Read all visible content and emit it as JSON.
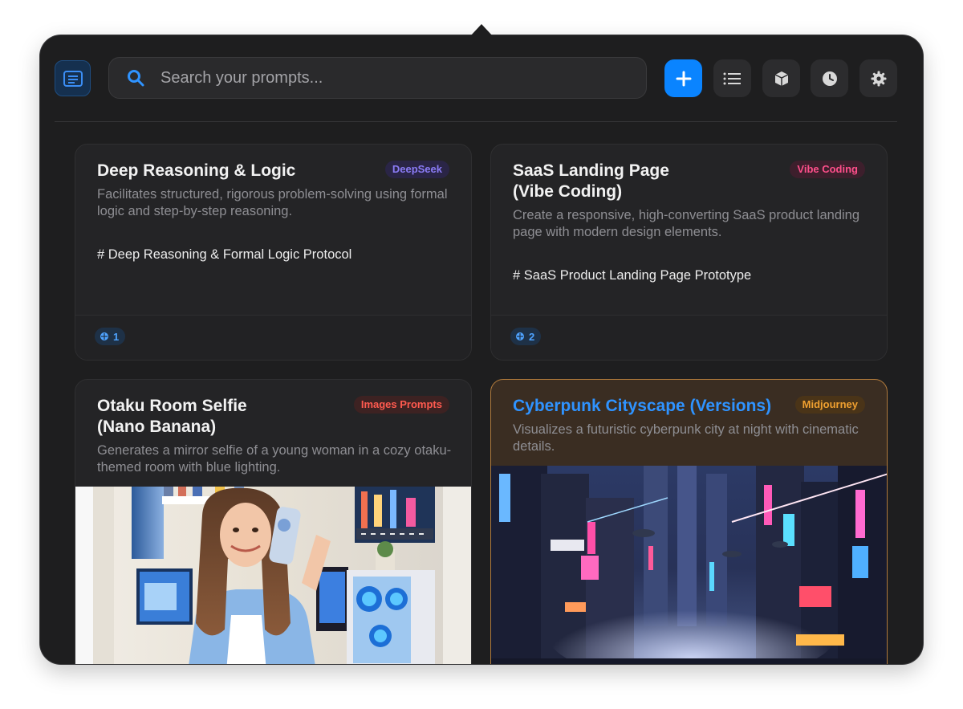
{
  "toolbar": {
    "search_placeholder": "Search your prompts...",
    "buttons": [
      "sidebar-toggle",
      "add",
      "list",
      "box",
      "history",
      "settings"
    ]
  },
  "colors": {
    "accent": "#0a84ff",
    "panel_bg": "#1e1e1f",
    "card_bg": "#242426"
  },
  "cards": [
    {
      "title": "Deep Reasoning & Logic",
      "tag": "DeepSeek",
      "tag_color": "#8b7cf6",
      "description": "Facilitates structured, rigorous problem-solving using formal logic and step-by-step reasoning.",
      "heading": "# Deep Reasoning & Formal Logic Protocol",
      "versions": "1"
    },
    {
      "title_line1": "SaaS Landing Page",
      "title_line2": "(Vibe Coding)",
      "tag": "Vibe Coding",
      "tag_color": "#ff4f8b",
      "description": "Create a responsive, high-converting SaaS product landing page with modern design elements.",
      "heading": "# SaaS Product Landing Page Prototype",
      "versions": "2"
    },
    {
      "title_line1": "Otaku Room Selfie",
      "title_line2": "(Nano Banana)",
      "tag": "Images Prompts",
      "tag_color": "#ff5a4f",
      "description": "Generates a mirror selfie of a young woman in a cozy otaku-themed room with blue lighting."
    },
    {
      "title": "Cyberpunk Cityscape (Versions)",
      "tag": "Midjourney",
      "tag_color": "#f0a030",
      "description": "Visualizes a futuristic cyberpunk city at night with cinematic details."
    }
  ]
}
